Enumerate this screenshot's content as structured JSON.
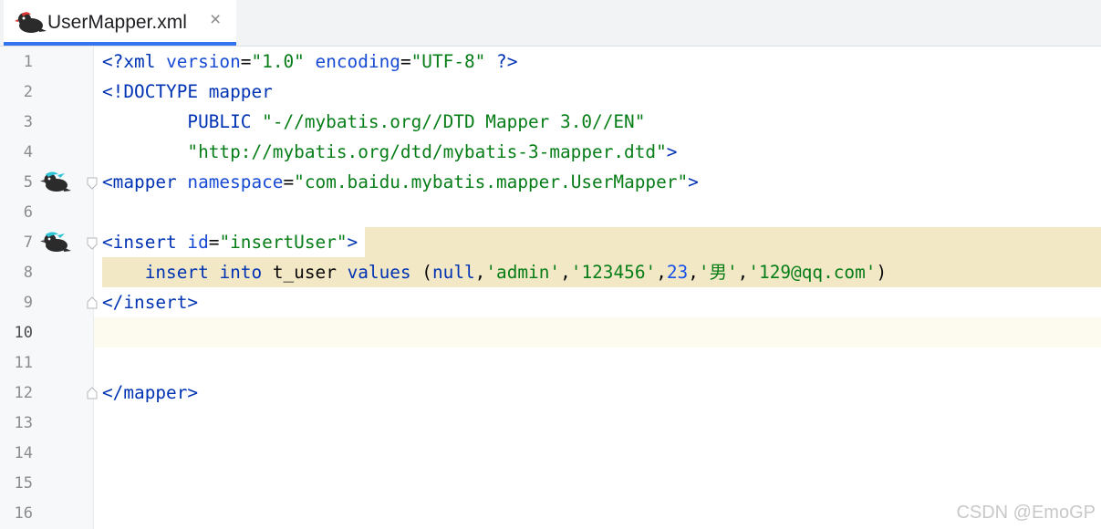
{
  "tab": {
    "title": "UserMapper.xml",
    "close_glyph": "×",
    "icon": "mybatis-bird-icon"
  },
  "line_numbers": [
    "1",
    "2",
    "3",
    "4",
    "5",
    "6",
    "7",
    "8",
    "9",
    "10",
    "11",
    "12",
    "13",
    "14",
    "15",
    "16"
  ],
  "current_line": "10",
  "code": {
    "l1": {
      "pi_open": "<?",
      "xml": "xml",
      "a1": " version",
      "eq1": "=",
      "v1": "\"1.0\"",
      "a2": " encoding",
      "eq2": "=",
      "v2": "\"UTF-8\"",
      "pi_close": " ?>"
    },
    "l2": {
      "doctype": "<!DOCTYPE mapper"
    },
    "l3": {
      "indent": "        ",
      "public": "PUBLIC",
      "space": " ",
      "str": "\"-//mybatis.org//DTD Mapper 3.0//EN\""
    },
    "l4": {
      "indent": "        ",
      "str": "\"http://mybatis.org/dtd/mybatis-3-mapper.dtd\"",
      "close": ">"
    },
    "l5": {
      "open": "<mapper",
      "attr": " namespace",
      "eq": "=",
      "val": "\"com.baidu.mybatis.mapper.UserMapper\"",
      "close": ">"
    },
    "l7": {
      "open": "<insert",
      "attr": " id",
      "eq": "=",
      "val": "\"insertUser\"",
      "close": ">"
    },
    "l8": {
      "indent": "    ",
      "kw1": "insert",
      "sp1": " ",
      "kw2": "into",
      "sp2": " ",
      "table": "t_user",
      "sp3": " ",
      "kw3": "values",
      "sp4": " (",
      "null": "null",
      "c1": ",",
      "s1": "'admin'",
      "c2": ",",
      "s2": "'123456'",
      "c3": ",",
      "n1": "23",
      "c4": ",",
      "s3": "'男'",
      "c5": ",",
      "s4": "'129@qq.com'",
      "end": ")"
    },
    "l9": {
      "close_tag": "</insert",
      "gt": ">"
    },
    "l12": {
      "close_tag": "</mapper",
      "gt": ">"
    }
  },
  "watermark": "CSDN @EmoGP",
  "colors": {
    "tag": "#0033b3",
    "string": "#067d17",
    "number": "#1750eb",
    "selection": "#f3e8c6",
    "current_line": "#fdfbf0",
    "accent": "#3574f0"
  }
}
